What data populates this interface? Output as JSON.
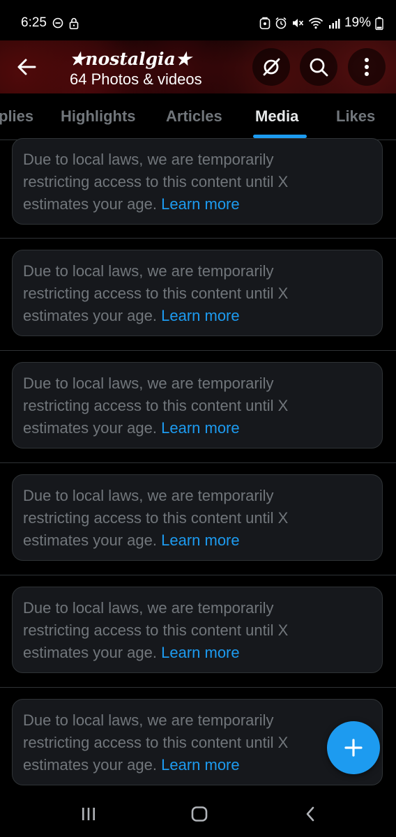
{
  "status_bar": {
    "time": "6:25",
    "battery": "19%",
    "left_icons": [
      "do-not-disturb-icon",
      "lock-icon"
    ],
    "right_icons": [
      "app-notification-icon",
      "alarm-icon",
      "mute-icon",
      "wifi-icon",
      "signal-icon",
      "battery-icon"
    ]
  },
  "header": {
    "profile_name": "★nostalgia★",
    "media_count": "64 Photos & videos",
    "icons": [
      "back-arrow-icon",
      "grok-icon",
      "search-icon",
      "more-vertical-icon"
    ]
  },
  "tabs": [
    {
      "label": "plies",
      "active": false
    },
    {
      "label": "Highlights",
      "active": false
    },
    {
      "label": "Articles",
      "active": false
    },
    {
      "label": "Media",
      "active": true
    },
    {
      "label": "Likes",
      "active": false
    }
  ],
  "notices": [
    {
      "line1": "Due to local laws, we are temporarily",
      "line2": "restricting access to this content until X",
      "line3": "estimates your age.",
      "link": "Learn more"
    },
    {
      "line1": "Due to local laws, we are temporarily",
      "line2": "restricting access to this content until X",
      "line3": "estimates your age.",
      "link": "Learn more"
    },
    {
      "line1": "Due to local laws, we are temporarily",
      "line2": "restricting access to this content until X",
      "line3": "estimates your age.",
      "link": "Learn more"
    },
    {
      "line1": "Due to local laws, we are temporarily",
      "line2": "restricting access to this content until X",
      "line3": "estimates your age.",
      "link": "Learn more"
    },
    {
      "line1": "Due to local laws, we are temporarily",
      "line2": "restricting access to this content until X",
      "line3": "estimates your age.",
      "link": "Learn more"
    },
    {
      "line1": "Due to local laws, we are temporarily",
      "line2": "restricting access to this content until X",
      "line3": "estimates your age.",
      "link": "Learn more"
    }
  ],
  "fab": {
    "icon": "plus-icon"
  },
  "nav_bar": {
    "icons": [
      "recent-apps-icon",
      "home-icon",
      "back-icon"
    ]
  },
  "colors": {
    "accent": "#1d9bf0",
    "muted_text": "#71767b",
    "card_bg": "#16181c",
    "border": "#2f3336"
  }
}
